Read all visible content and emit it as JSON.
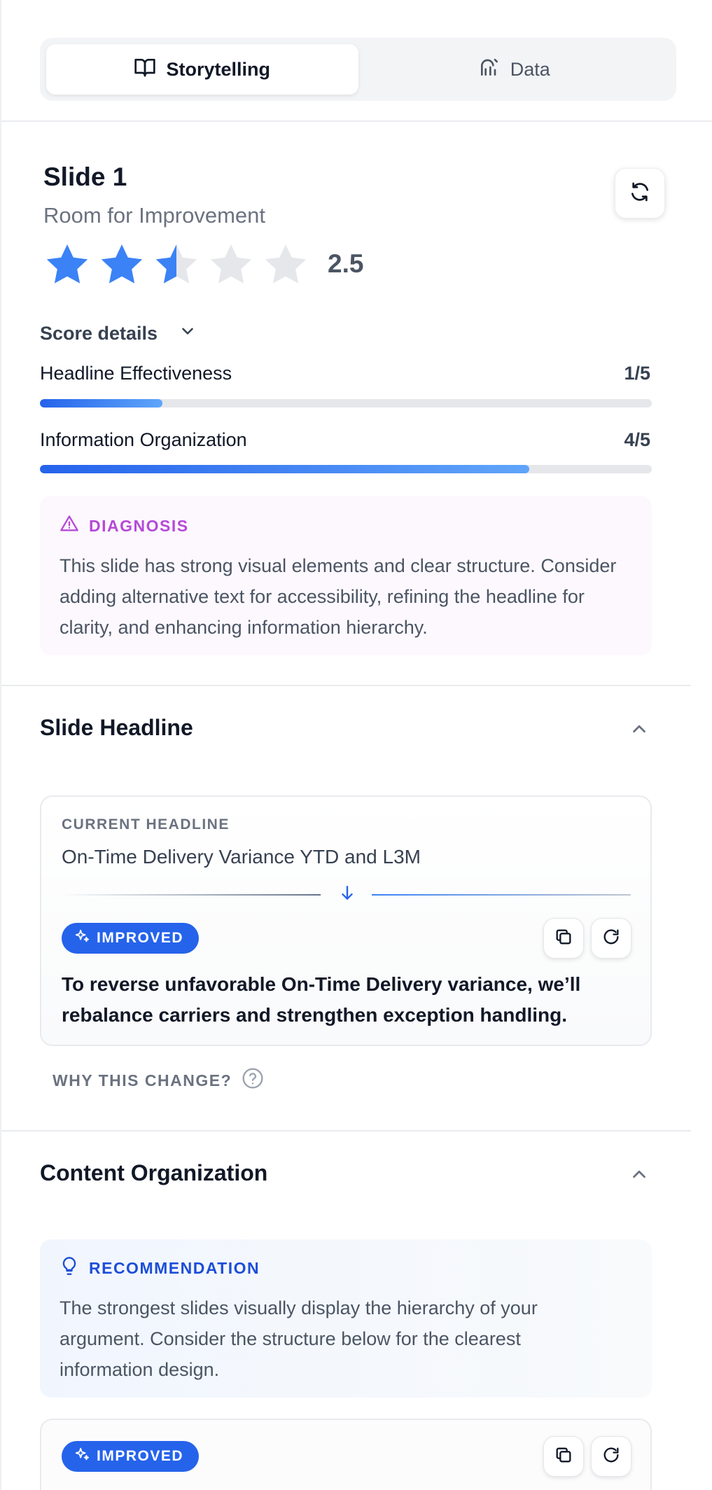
{
  "tabs": [
    {
      "label": "Storytelling",
      "icon": "book-open-icon",
      "active": true
    },
    {
      "label": "Data",
      "icon": "chart-icon",
      "active": false
    }
  ],
  "slide": {
    "title": "Slide 1",
    "subtitle": "Room for Improvement",
    "rating": 2.5,
    "rating_max": 5,
    "rating_label": "2.5"
  },
  "score_details": {
    "label": "Score details",
    "metrics": [
      {
        "label": "Headline Effectiveness",
        "value_label": "1/5",
        "value": 1,
        "max": 5
      },
      {
        "label": "Information Organization",
        "value_label": "4/5",
        "value": 4,
        "max": 5
      }
    ]
  },
  "diagnosis": {
    "label": "DIAGNOSIS",
    "text": "This slide has strong visual elements and clear structure. Consider adding alternative text for accessibility, refining the headline for clarity, and enhancing information hierarchy."
  },
  "headline_section": {
    "title": "Slide Headline",
    "current_label": "CURRENT HEADLINE",
    "current_text": "On-Time Delivery Variance YTD and L3M",
    "badge": "IMPROVED",
    "improved_text": "To reverse unfavorable On-Time Delivery variance, we’ll rebalance carriers and strengthen exception handling.",
    "why_label": "WHY THIS CHANGE?"
  },
  "content_section": {
    "title": "Content Organization",
    "rec_label": "RECOMMENDATION",
    "rec_text": "The strongest slides visually display the hierarchy of your argument. Consider the structure below for the clearest information design.",
    "badge": "IMPROVED"
  },
  "colors": {
    "accent": "#2563eb",
    "star_filled": "#3b82f6",
    "star_empty": "#e5e7eb",
    "diagnosis": "#b54ad8"
  }
}
